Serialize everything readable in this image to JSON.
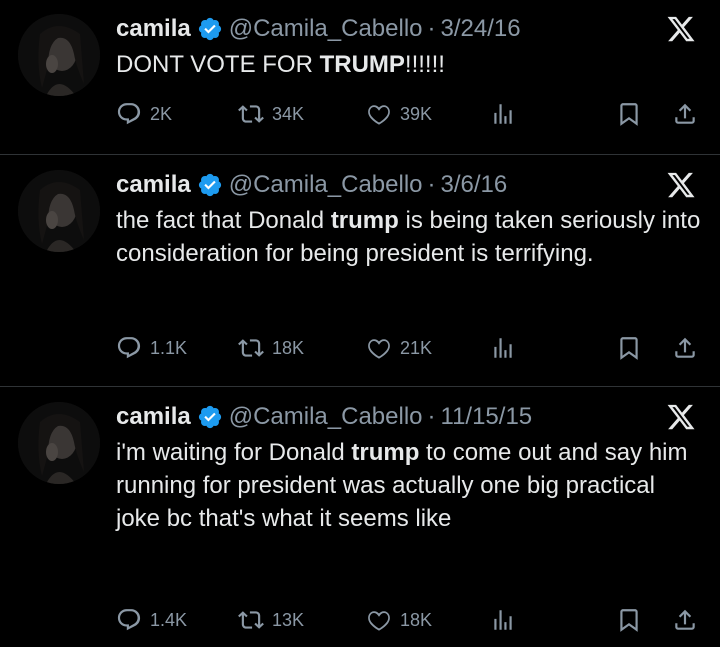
{
  "tweets": [
    {
      "display_name": "camila",
      "handle": "@Camila_Cabello",
      "separator": "·",
      "date": "3/24/16",
      "text_parts": [
        "DONT VOTE FOR ",
        "TRUMP",
        "!!!!!!"
      ],
      "replies": "2K",
      "retweets": "34K",
      "likes": "39K"
    },
    {
      "display_name": "camila",
      "handle": "@Camila_Cabello",
      "separator": "·",
      "date": "3/6/16",
      "text_parts": [
        "the fact that Donald ",
        "trump",
        " is being taken seriously into consideration for being president is terrifying."
      ],
      "replies": "1.1K",
      "retweets": "18K",
      "likes": "21K"
    },
    {
      "display_name": "camila",
      "handle": "@Camila_Cabello",
      "separator": "·",
      "date": "11/15/15",
      "text_parts": [
        "i'm waiting for Donald ",
        "trump",
        " to come out and say him running for president was actually one big practical joke bc that's what it seems like"
      ],
      "replies": "1.4K",
      "retweets": "13K",
      "likes": "18K"
    }
  ],
  "icons": {
    "verified": "verified-badge-icon",
    "platform": "x-logo-icon",
    "reply": "reply-icon",
    "retweet": "retweet-icon",
    "like": "heart-icon",
    "views": "views-icon",
    "bookmark": "bookmark-icon",
    "share": "share-icon"
  },
  "colors": {
    "background": "#000000",
    "text": "#e7e9ea",
    "muted": "#8b98a5",
    "verified": "#1d9bf0",
    "divider": "#2f3336"
  }
}
